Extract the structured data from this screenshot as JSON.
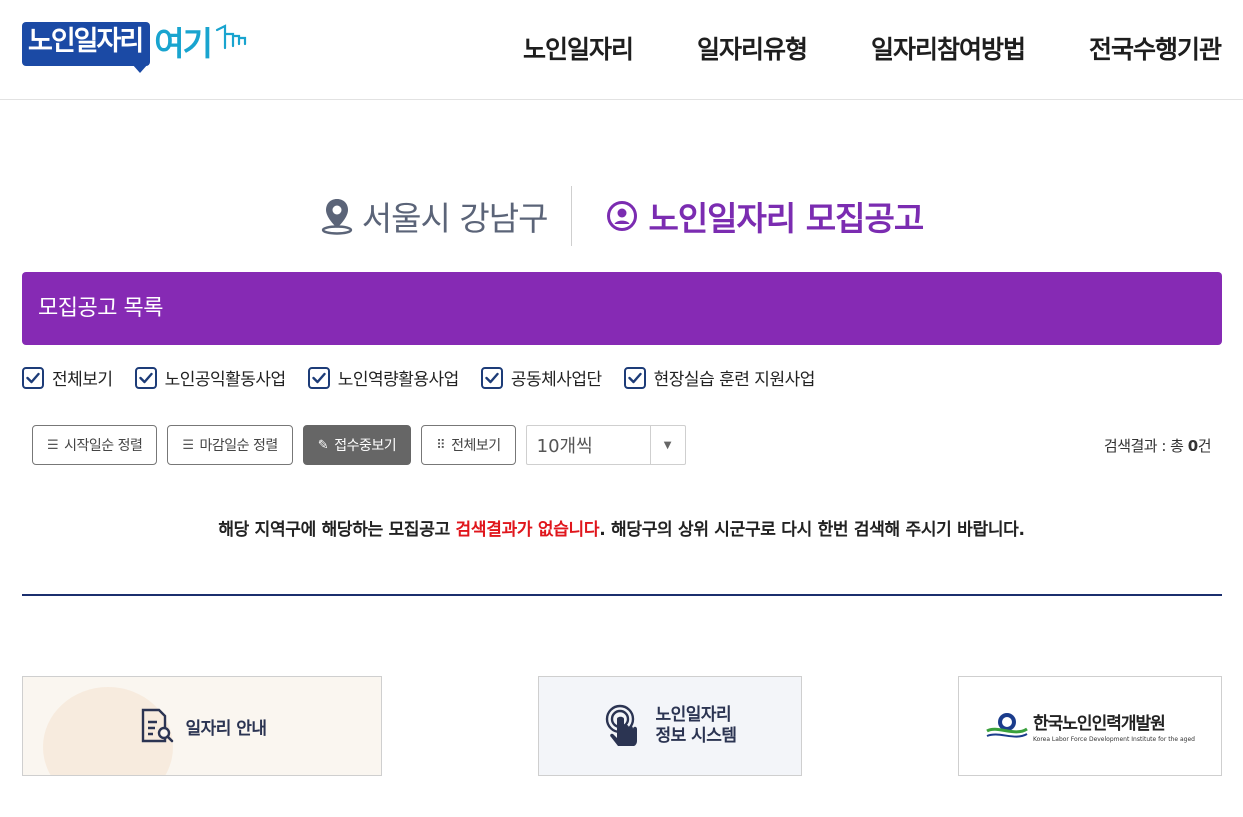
{
  "header": {
    "logo_main": "노인일자리",
    "logo_accent": "여기",
    "nav": [
      "노인일자리",
      "일자리유형",
      "일자리참여방법",
      "전국수행기관"
    ]
  },
  "page": {
    "location": "서울시 강남구",
    "title": "노인일자리 모집공고",
    "list_bar": "모집공고 목록"
  },
  "filters": [
    "전체보기",
    "노인공익활동사업",
    "노인역량활용사업",
    "공동체사업단",
    "현장실습 훈련 지원사업"
  ],
  "toolbar": {
    "sort_start": "시작일순 정렬",
    "sort_end": "마감일순 정렬",
    "open_only": "접수중보기",
    "view_all": "전체보기",
    "page_size": "10개씩",
    "result_prefix": "검색결과 : 총 ",
    "result_count": "0",
    "result_suffix": "건"
  },
  "message": {
    "part1": "해당 지역구에 해당하는 모집공고 ",
    "part2": "검색결과가 없습니다",
    "part3": ". 해당구의 상위 시군구로 다시 한번 검색해 주시기 바랍니다."
  },
  "banners": {
    "guide": "일자리 안내",
    "system_line1": "노인일자리",
    "system_line2": "정보 시스템",
    "agency_kr": "한국노인인력개발원",
    "agency_en": "Korea Labor Force Development Institute for the aged"
  },
  "colors": {
    "brand_purple": "#862ab4",
    "logo_blue": "#1b4aa5",
    "logo_cyan": "#19a4cf",
    "alert_red": "#e0161c"
  }
}
